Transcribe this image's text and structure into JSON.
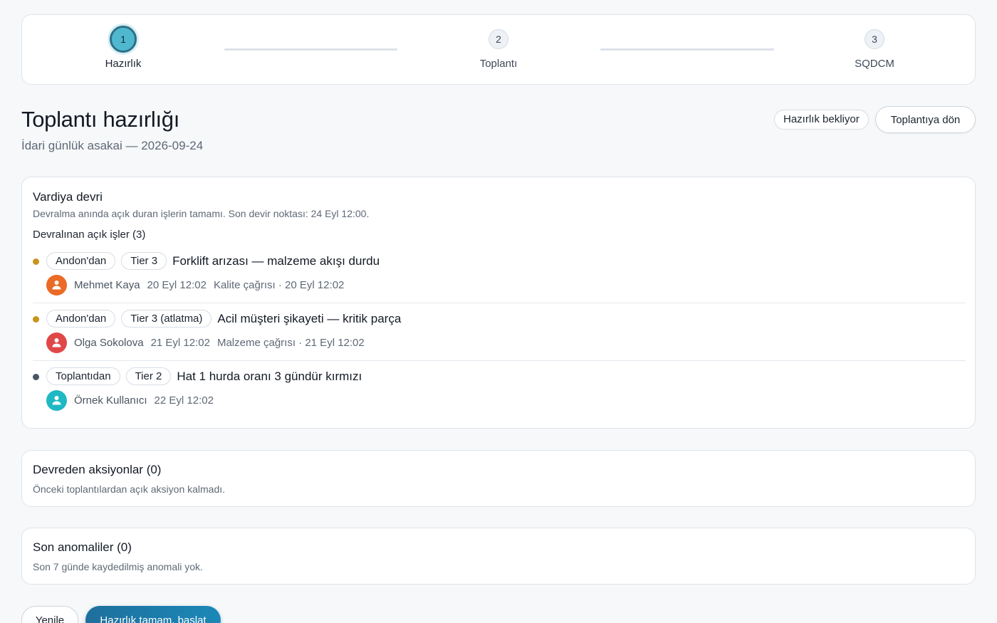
{
  "stepper": {
    "steps": [
      {
        "number": "1",
        "label": "Hazırlık"
      },
      {
        "number": "2",
        "label": "Toplantı"
      },
      {
        "number": "3",
        "label": "SQDCM"
      }
    ]
  },
  "header": {
    "title": "Toplantı hazırlığı",
    "subtitle": "İdari günlük asakai — 2026-09-24",
    "status_badge": "Hazırlık bekliyor",
    "back_button": "Toplantıya dön"
  },
  "shift_handover": {
    "title": "Vardiya devri",
    "description": "Devralma anında açık duran işlerin tamamı. Son devir noktası: 24 Eyl 12:00.",
    "open_items_heading": "Devralınan açık işler (3)",
    "items": [
      {
        "source": "Andon'dan",
        "tier": "Tier 3",
        "title": "Forklift arızası — malzeme akışı durdu",
        "owner": "Mehmet Kaya",
        "date": "20 Eyl 12:02",
        "detail": "Kalite çağrısı · 20 Eyl 12:02",
        "dot_color": "#c8941b",
        "avatar_color": "#ea6a26"
      },
      {
        "source": "Andon'dan",
        "tier": "Tier 3 (atlatma)",
        "title": "Acil müşteri şikayeti — kritik parça",
        "owner": "Olga Sokolova",
        "date": "21 Eyl 12:02",
        "detail": "Malzeme çağrısı · 21 Eyl 12:02",
        "dot_color": "#c8941b",
        "avatar_color": "#e04848"
      },
      {
        "source": "Toplantıdan",
        "tier": "Tier 2",
        "title": "Hat 1 hurda oranı 3 gündür kırmızı",
        "owner": "Örnek Kullanıcı",
        "date": "22 Eyl 12:02",
        "detail": "",
        "dot_color": "#4a5666",
        "avatar_color": "#1fb8c3"
      }
    ]
  },
  "carried_actions": {
    "title": "Devreden aksiyonlar (0)",
    "description": "Önceki toplantılardan açık aksiyon kalmadı."
  },
  "recent_anomalies": {
    "title": "Son anomaliler (0)",
    "description": "Son 7 günde kaydedilmiş anomali yok."
  },
  "footer": {
    "refresh_button": "Yenile",
    "start_button": "Hazırlık tamam, başlat"
  }
}
